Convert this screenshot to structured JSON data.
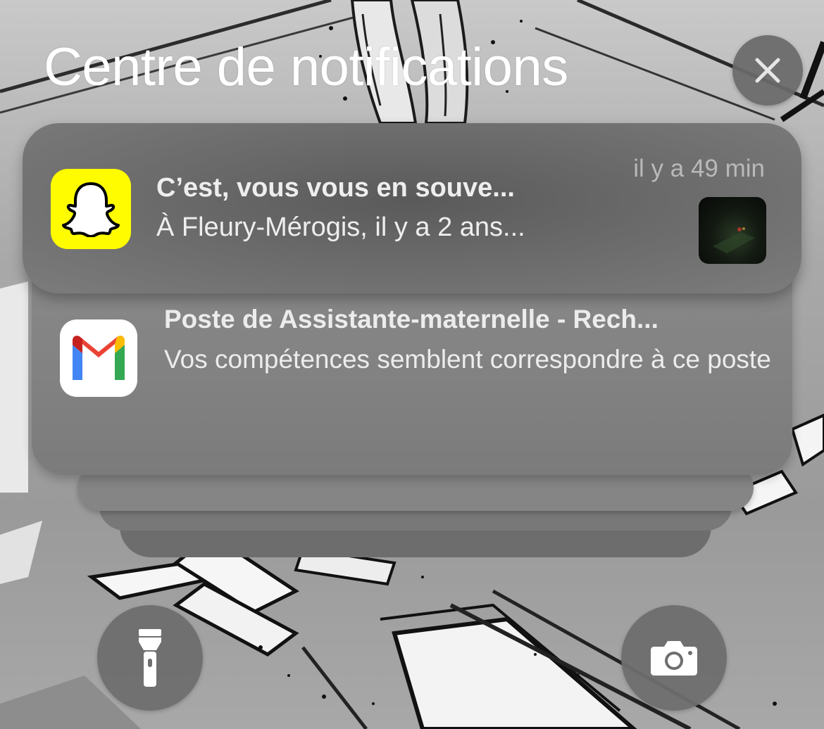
{
  "header": {
    "title": "Centre de notifications",
    "close_icon": "close-icon"
  },
  "notifications": [
    {
      "app": "Snapchat",
      "icon": "snapchat-ghost-icon",
      "accent": "#fffc00",
      "time": "il y a 49 min",
      "title": "C’est, vous vous en souve...",
      "body": "À Fleury-Mérogis, il y a 2 ans...",
      "has_thumbnail": true
    },
    {
      "app": "Gmail",
      "icon": "gmail-icon",
      "title": "Poste de Assistante-maternelle - Rech...",
      "body": "Vos compétences semblent correspondre à ce poste"
    }
  ],
  "bottom_controls": {
    "left": "flashlight-icon",
    "right": "camera-icon"
  },
  "colors": {
    "gmail_red": "#ea4335",
    "gmail_blue": "#4285f4",
    "gmail_green": "#34a853",
    "gmail_yellow": "#fbbc04"
  }
}
